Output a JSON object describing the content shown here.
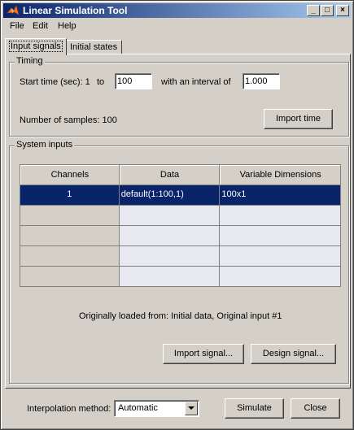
{
  "window": {
    "title": "Linear Simulation Tool",
    "controls": {
      "minimize": "_",
      "maximize": "□",
      "close": "×"
    }
  },
  "menu": [
    "File",
    "Edit",
    "Help"
  ],
  "tabs": [
    {
      "label": "Input signals",
      "active": true
    },
    {
      "label": "Initial states",
      "active": false
    }
  ],
  "timing": {
    "group_label": "Timing",
    "start_label": "Start time (sec): 1",
    "to_label": "to",
    "end_value": "100",
    "interval_label": "with an interval of",
    "interval_value": "1.000",
    "samples_label": "Number of samples: 100",
    "import_time_button": "Import time"
  },
  "system_inputs": {
    "group_label": "System inputs",
    "columns": [
      "Channels",
      "Data",
      "Variable Dimensions"
    ],
    "rows": [
      [
        "1",
        "default(1:100,1)",
        "100x1"
      ],
      [
        "",
        "",
        ""
      ],
      [
        "",
        "",
        ""
      ],
      [
        "",
        "",
        ""
      ],
      [
        "",
        "",
        ""
      ]
    ],
    "originally_loaded": "Originally loaded from:  Initial data, Original input #1",
    "import_signal_button": "Import signal...",
    "design_signal_button": "Design signal..."
  },
  "footer": {
    "interpolation_label": "Interpolation method:",
    "interpolation_value": "Automatic",
    "simulate_button": "Simulate",
    "close_button": "Close"
  },
  "colors": {
    "titlebar_start": "#0a246a",
    "selection": "#0a246a",
    "face": "#d4d0c8"
  }
}
